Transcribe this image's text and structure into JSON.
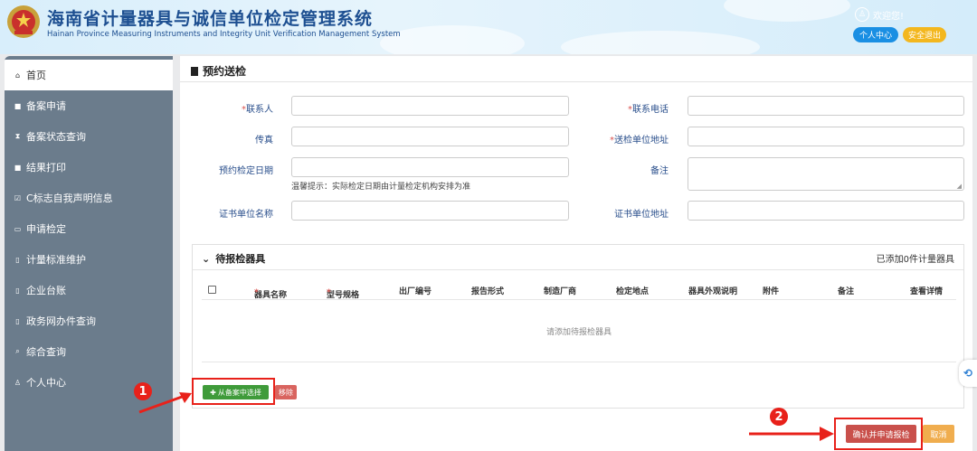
{
  "header": {
    "title_cn": "海南省计量器具与诚信单位检定管理系统",
    "title_en": "Hainan Province Measuring Instruments and Integrity Unit Verification Management System",
    "welcome": "欢迎您!",
    "personal_center_btn": "个人中心",
    "logout_btn": "安全退出"
  },
  "sidebar": {
    "items": [
      {
        "label": "首页",
        "icon": "home-icon",
        "glyph": "⌂"
      },
      {
        "label": "备案申请",
        "icon": "list-icon",
        "glyph": "■"
      },
      {
        "label": "备案状态查询",
        "icon": "hourglass-icon",
        "glyph": "⧗"
      },
      {
        "label": "结果打印",
        "icon": "print-icon",
        "glyph": "■"
      },
      {
        "label": "C标志自我声明信息",
        "icon": "checkbox-icon",
        "glyph": "☑"
      },
      {
        "label": "申请检定",
        "icon": "card-icon",
        "glyph": "▭"
      },
      {
        "label": "计量标准维护",
        "icon": "file-icon",
        "glyph": "▯"
      },
      {
        "label": "企业台账",
        "icon": "file-icon",
        "glyph": "▯"
      },
      {
        "label": "政务网办件查询",
        "icon": "file-icon",
        "glyph": "▯"
      },
      {
        "label": "综合查询",
        "icon": "search-icon",
        "glyph": "⌕"
      },
      {
        "label": "个人中心",
        "icon": "user-icon",
        "glyph": "♙"
      }
    ]
  },
  "main": {
    "section_title": "预约送检",
    "form": {
      "contact_label": "联系人",
      "contact_phone_label": "联系电话",
      "fax_label": "传真",
      "unit_address_label": "送检单位地址",
      "appointment_date_label": "预约检定日期",
      "remark_label": "备注",
      "tip": "温馨提示：实际检定日期由计量检定机构安排为准",
      "cert_unit_name_label": "证书单位名称",
      "cert_unit_address_label": "证书单位地址",
      "required_mark": "*"
    },
    "pending": {
      "title": "待报检器具",
      "count_text": "已添加0件计量器具",
      "columns": [
        "器具名称",
        "型号规格",
        "出厂编号",
        "报告形式",
        "制造厂商",
        "检定地点",
        "器具外观说明",
        "附件",
        "备注",
        "查看详情"
      ],
      "empty_text": "请添加待报检器具"
    },
    "add_from_record_btn": "从备案中选择",
    "remove_btn": "移除",
    "confirm_btn": "确认并申请报检",
    "cancel_btn": "取消"
  },
  "annotations": [
    "1",
    "2"
  ],
  "colors": {
    "accent_blue": "#1a8fe3",
    "logout_yellow": "#f3b71e",
    "sidebar_bg": "#6b7c8c",
    "confirm_red": "#c9504b",
    "annotation_red": "#e8211a"
  }
}
